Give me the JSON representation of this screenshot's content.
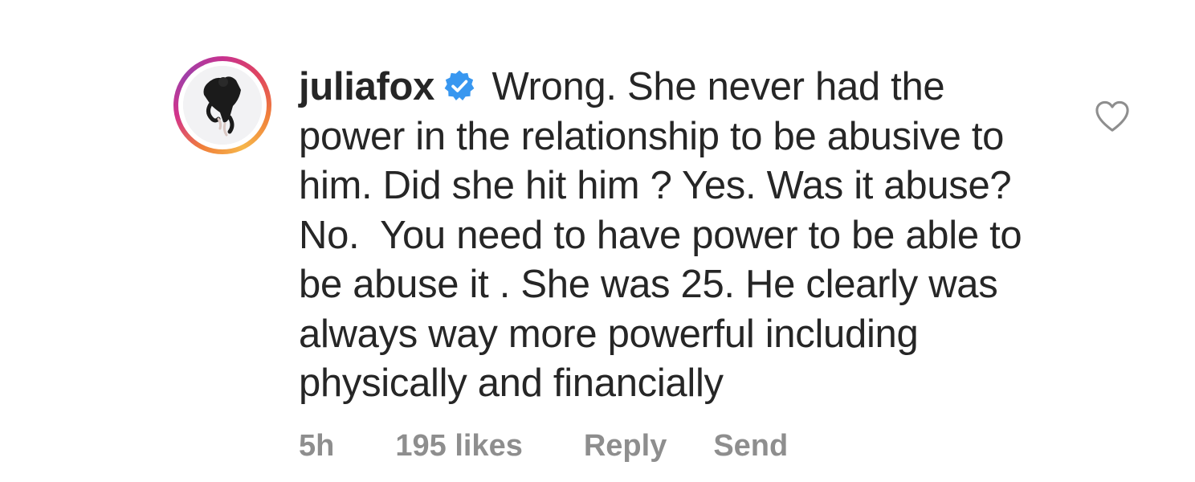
{
  "comment": {
    "username": "juliafox",
    "verified": true,
    "text": "Wrong. She never had the power in the relationship to be abusive to him. Did she hit him ? Yes. Was it abuse? No.  You need to have power to be able to be abuse it . She was 25. He clearly was always way more powerful including physically and financially",
    "time": "5h",
    "likes": "195 likes",
    "reply_label": "Reply",
    "send_label": "Send"
  },
  "icons": {
    "avatar": "avatar-photo",
    "verified": "verified-badge-icon",
    "like": "heart-outline-icon"
  },
  "colors": {
    "text": "#262626",
    "meta": "#8e8e8e",
    "verified_blue": "#3897f0"
  }
}
